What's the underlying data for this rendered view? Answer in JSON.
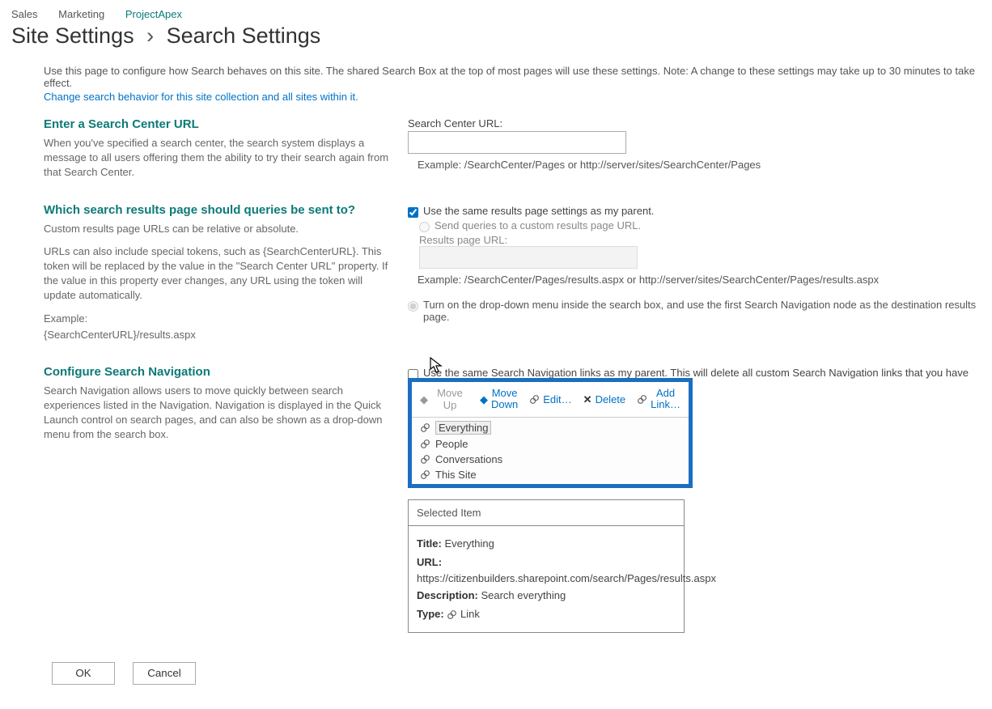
{
  "breadcrumbs": {
    "a": "Sales",
    "b": "Marketing",
    "c": "ProjectApex"
  },
  "title": {
    "a": "Site Settings",
    "b": "Search Settings"
  },
  "intro": "Use this page to configure how Search behaves on this site. The shared Search Box at the top of most pages will use these settings. Note: A change to these settings may take up to 30 minutes to take effect.",
  "intro_link": "Change search behavior for this site collection and all sites within it.",
  "s1": {
    "h": "Enter a Search Center URL",
    "p": "When you've specified a search center, the search system displays a message to all users offering them the ability to try their search again from that Search Center.",
    "label": "Search Center URL:",
    "help": "Example: /SearchCenter/Pages or http://server/sites/SearchCenter/Pages"
  },
  "s2": {
    "h": "Which search results page should queries be sent to?",
    "p1": "Custom results page URLs can be relative or absolute.",
    "p2": "URLs can also include special tokens, such as {SearchCenterURL}. This token will be replaced by the value in the \"Search Center URL\" property. If the value in this property ever changes, any URL using the token will update automatically.",
    "p3": "Example:",
    "p4": "{SearchCenterURL}/results.aspx",
    "chk": "Use the same results page settings as my parent.",
    "rad1": "Send queries to a custom results page URL.",
    "rurl": "Results page URL:",
    "help": "Example: /SearchCenter/Pages/results.aspx or http://server/sites/SearchCenter/Pages/results.aspx",
    "rad2": "Turn on the drop-down menu inside the search box, and use the first Search Navigation node as the destination results page."
  },
  "s3": {
    "h": "Configure Search Navigation",
    "p": "Search Navigation allows users to move quickly between search experiences listed in the Navigation. Navigation is displayed in the Quick Launch control on search pages, and can also be shown as a drop-down menu from the search box.",
    "parent_chk": "Use the same Search Navigation links as my parent. This will delete all custom Search Navigation links that you have created for this site.",
    "tools": {
      "up": "Move Up",
      "down_a": "Move",
      "down_b": "Down",
      "edit": "Edit…",
      "del": "Delete",
      "add_a": "Add",
      "add_b": "Link…"
    },
    "items": [
      "Everything",
      "People",
      "Conversations",
      "This Site"
    ],
    "sel_head": "Selected Item",
    "sel": {
      "title_k": "Title:",
      "title_v": "Everything",
      "url_k": "URL:",
      "url_v": "https://citizenbuilders.sharepoint.com/search/Pages/results.aspx",
      "desc_k": "Description:",
      "desc_v": "Search everything",
      "type_k": "Type:",
      "type_v": "Link"
    }
  },
  "buttons": {
    "ok": "OK",
    "cancel": "Cancel"
  }
}
